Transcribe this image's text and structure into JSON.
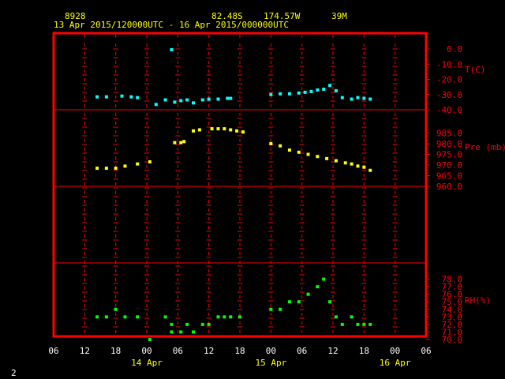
{
  "header": {
    "station": "8928",
    "lat": "82.48S",
    "lon": "174.57W",
    "elev": "39M",
    "period": "13 Apr 2015/120000UTC - 16 Apr 2015/000000UTC"
  },
  "page_number": "2",
  "x_axis": {
    "hour_labels": [
      "06",
      "12",
      "18",
      "00",
      "06",
      "12",
      "18",
      "00",
      "06",
      "12",
      "18",
      "00",
      "06"
    ],
    "date_labels": [
      "14 Apr",
      "15 Apr",
      "16 Apr"
    ]
  },
  "colors": {
    "frame": "#ff0000",
    "temp": "#00ffff",
    "pres": "#ffff00",
    "rh": "#00ff00",
    "hour_text": "#ffffff",
    "header_text": "#ffff00"
  },
  "chart_data": [
    {
      "type": "scatter",
      "x_unit": "hours since 13 Apr 2015 06 UTC",
      "xlim": [
        0,
        72
      ],
      "ylabel": "T(C)",
      "ylim": [
        -40,
        0
      ],
      "yticks": [
        "0.0",
        "-10.0",
        "-20.0",
        "-30.0",
        "-40.0"
      ],
      "ytick_values": [
        0,
        -10,
        -20,
        -30,
        -40
      ],
      "series": [
        {
          "x": [
            8.4,
            10.2,
            13.2,
            15.0,
            16.2,
            19.8,
            21.6,
            22.8,
            23.4,
            24.6,
            25.8,
            27.0,
            28.8,
            30.0,
            31.8,
            33.6,
            34.2,
            42.0,
            43.8,
            45.6,
            47.4,
            48.6,
            49.8,
            51.0,
            52.2,
            53.4,
            54.6,
            55.8,
            57.6,
            58.8,
            60.0,
            61.2
          ],
          "y": [
            -31.5,
            -31.5,
            -31.0,
            -31.5,
            -32.0,
            -36.5,
            -33.5,
            -0.5,
            -35.0,
            -34.0,
            -33.5,
            -35.5,
            -33.5,
            -33.0,
            -33.0,
            -32.5,
            -32.5,
            -30.0,
            -29.5,
            -29.5,
            -29.0,
            -28.5,
            -28.0,
            -27.0,
            -26.5,
            -24.0,
            -27.5,
            -32.0,
            -33.0,
            -32.0,
            -32.5,
            -33.0
          ]
        }
      ]
    },
    {
      "type": "scatter",
      "x_unit": "hours since 13 Apr 2015 06 UTC",
      "xlim": [
        0,
        72
      ],
      "ylabel": "Pre (mb)",
      "ylim": [
        960,
        990
      ],
      "yticks": [
        "985.0",
        "980.0",
        "975.0",
        "970.0",
        "965.0",
        "960.0"
      ],
      "ytick_values": [
        985,
        980,
        975,
        970,
        965,
        960
      ],
      "series": [
        {
          "x": [
            8.4,
            10.2,
            12.0,
            13.8,
            16.2,
            18.6,
            23.4,
            24.6,
            25.2,
            27.0,
            28.2,
            30.6,
            31.8,
            33.0,
            34.2,
            35.4,
            36.6,
            42.0,
            43.8,
            45.6,
            47.4,
            49.2,
            51.0,
            52.8,
            54.6,
            56.4,
            57.6,
            58.8,
            60.0,
            61.2
          ],
          "y": [
            968.5,
            968.5,
            968.5,
            969.5,
            970.5,
            971.5,
            980.5,
            980.5,
            981.0,
            986.0,
            986.5,
            987.0,
            987.0,
            987.0,
            986.5,
            986.0,
            985.5,
            980.0,
            979.0,
            977.0,
            976.0,
            975.0,
            974.0,
            973.0,
            972.0,
            971.0,
            970.5,
            969.5,
            969.0,
            967.5
          ]
        }
      ]
    },
    {
      "type": "scatter",
      "x_unit": "hours since 13 Apr 2015 06 UTC",
      "xlim": [
        0,
        72
      ],
      "ylabel": "RH(%)",
      "ylim": [
        70,
        79
      ],
      "yticks": [
        "78.0",
        "77.0",
        "76.0",
        "75.0",
        "74.0",
        "73.0",
        "72.0",
        "71.0",
        "70.0"
      ],
      "ytick_values": [
        78,
        77,
        76,
        75,
        74,
        73,
        72,
        71,
        70
      ],
      "series": [
        {
          "x": [
            8.4,
            10.2,
            12.0,
            13.8,
            16.2,
            18.6,
            21.6,
            22.8,
            22.8,
            24.6,
            25.8,
            27.0,
            28.8,
            30.0,
            31.8,
            33.0,
            34.2,
            36.0,
            42.0,
            43.8,
            45.6,
            47.4,
            49.2,
            51.0,
            52.2,
            53.4,
            54.6,
            55.8,
            57.6,
            58.8,
            60.0,
            61.2
          ],
          "y": [
            73.0,
            73.0,
            74.0,
            73.0,
            73.0,
            70.0,
            73.0,
            72.0,
            71.0,
            71.0,
            72.0,
            71.0,
            72.0,
            72.0,
            73.0,
            73.0,
            73.0,
            73.0,
            74.0,
            74.0,
            75.0,
            75.0,
            76.0,
            77.0,
            78.0,
            75.0,
            73.0,
            72.0,
            73.0,
            72.0,
            72.0,
            72.0
          ]
        }
      ]
    }
  ]
}
